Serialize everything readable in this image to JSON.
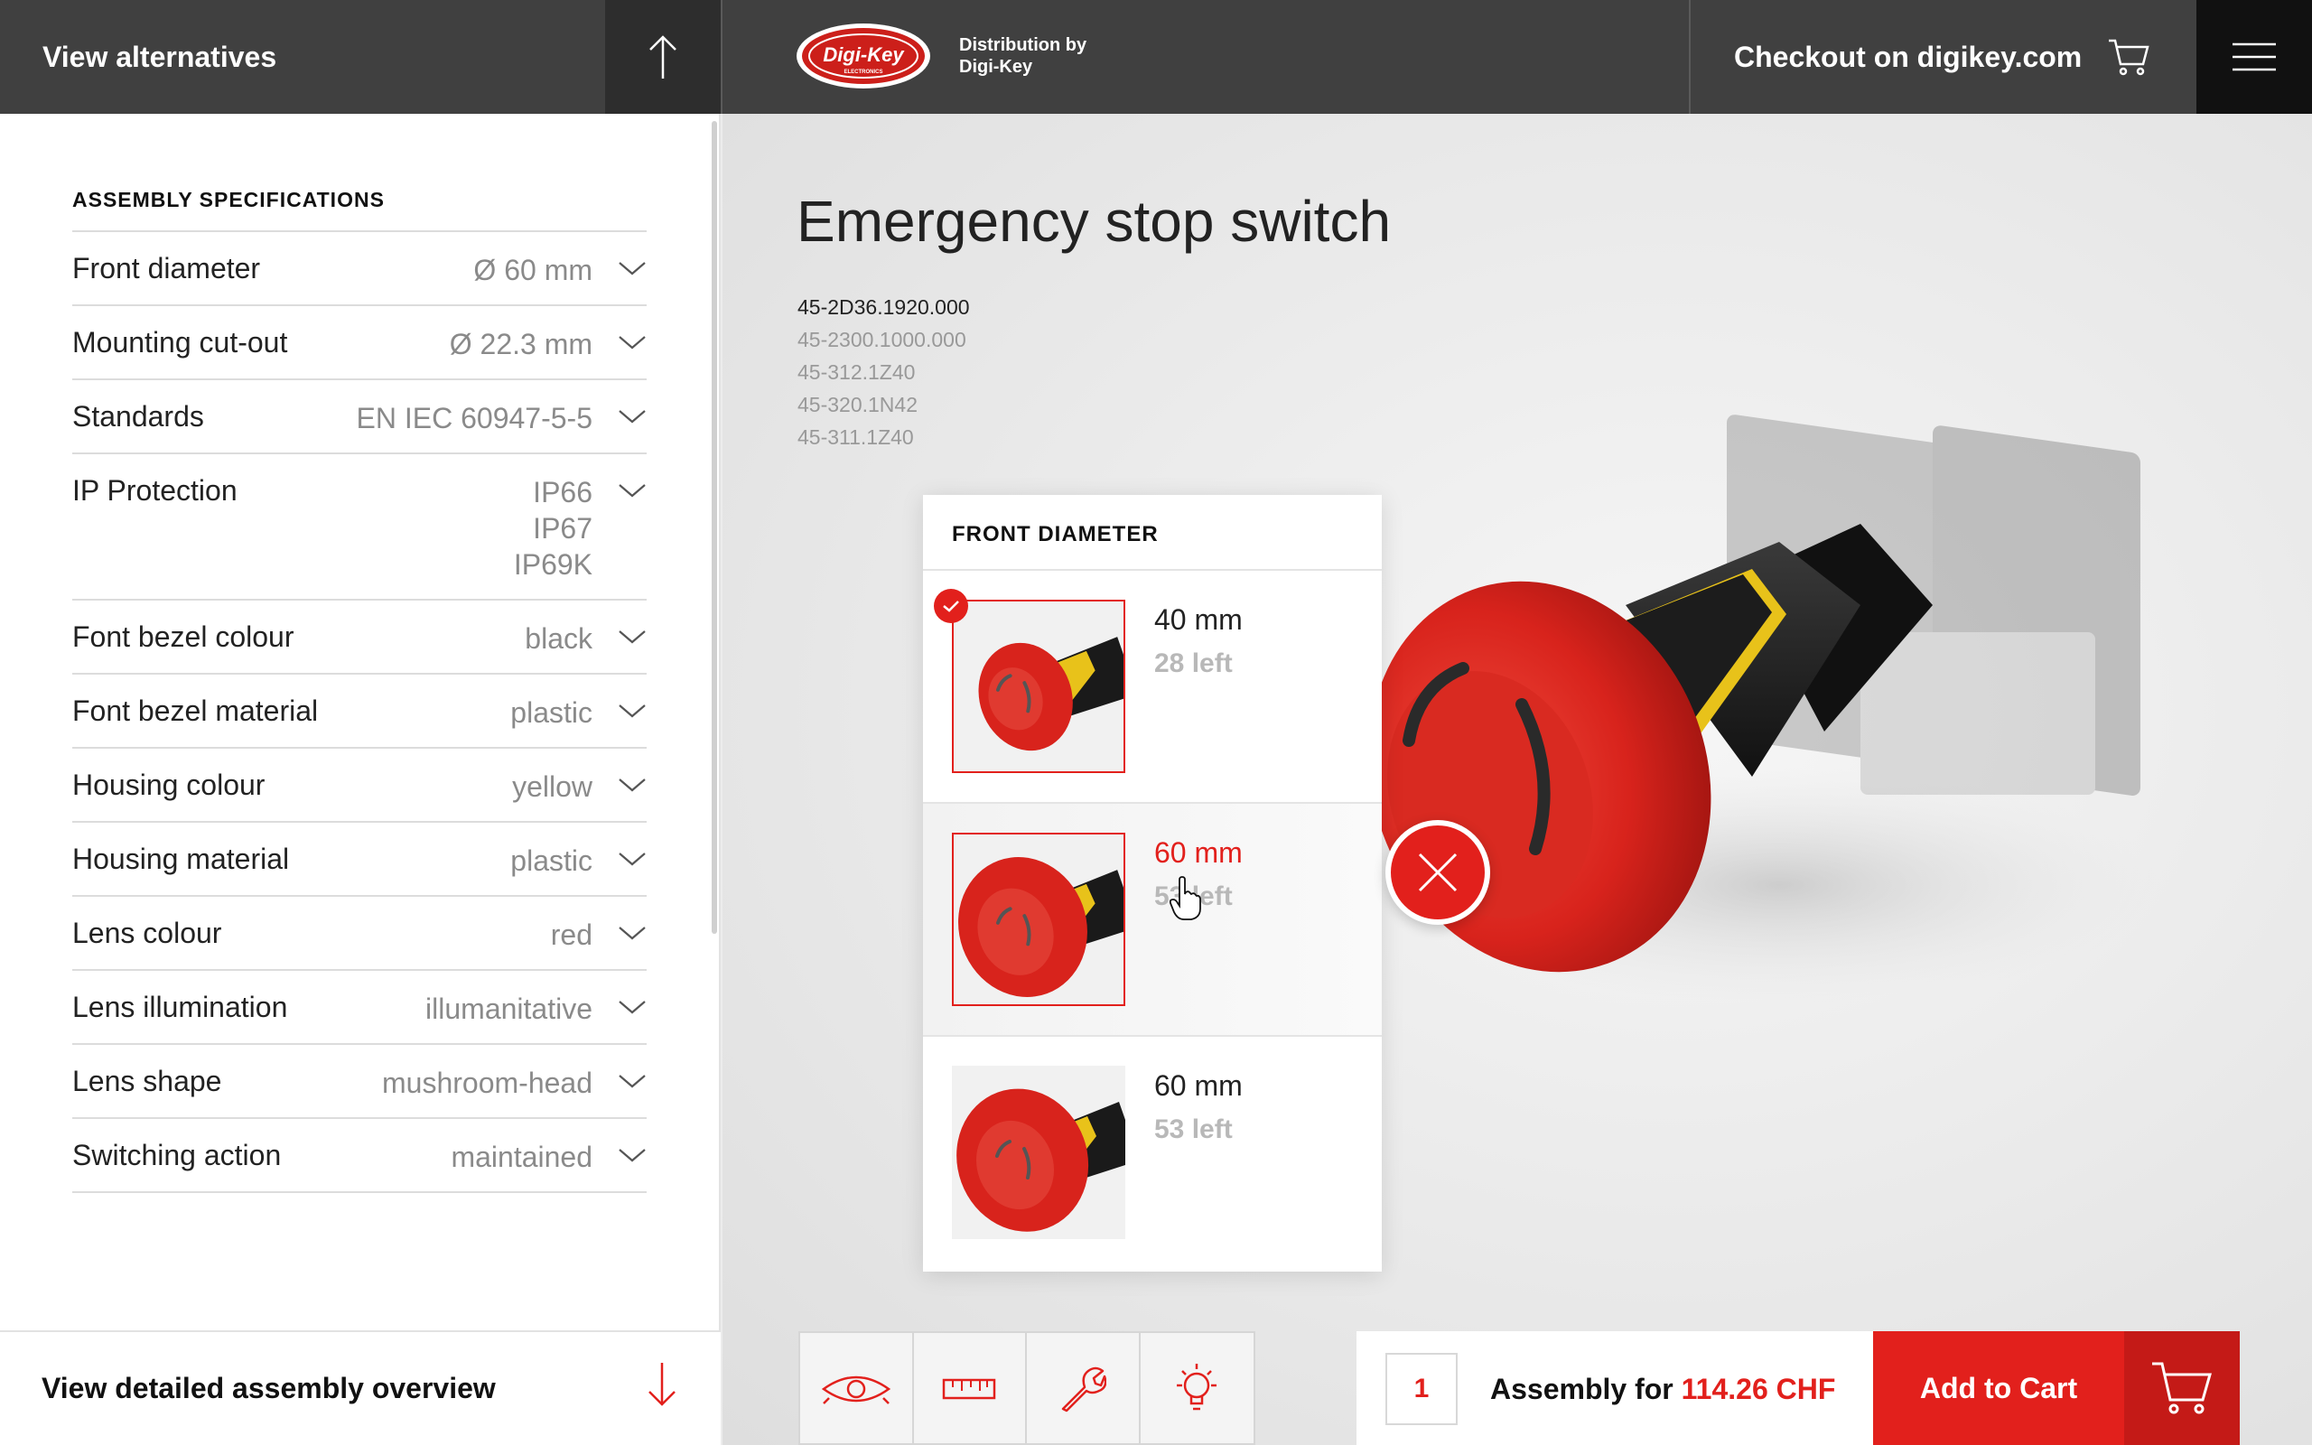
{
  "header": {
    "alternatives_label": "View alternatives",
    "distribution_line1": "Distribution by",
    "distribution_line2": "Digi-Key",
    "logo_text": "Digi-Key",
    "logo_sub": "ELECTRONICS",
    "checkout_label": "Checkout on digikey.com"
  },
  "specs": {
    "title": "ASSEMBLY SPECIFICATIONS",
    "rows": [
      {
        "label": "Front diameter",
        "values": [
          "Ø 60 mm"
        ]
      },
      {
        "label": "Mounting cut-out",
        "values": [
          "Ø 22.3 mm"
        ]
      },
      {
        "label": "Standards",
        "values": [
          "EN IEC 60947-5-5"
        ]
      },
      {
        "label": "IP Protection",
        "values": [
          "IP66",
          "IP67",
          "IP69K"
        ]
      },
      {
        "label": "Font bezel colour",
        "values": [
          "black"
        ]
      },
      {
        "label": "Font bezel material",
        "values": [
          "plastic"
        ]
      },
      {
        "label": "Housing colour",
        "values": [
          "yellow"
        ]
      },
      {
        "label": "Housing material",
        "values": [
          "plastic"
        ]
      },
      {
        "label": "Lens colour",
        "values": [
          "red"
        ]
      },
      {
        "label": "Lens illumination",
        "values": [
          "illumanitative"
        ]
      },
      {
        "label": "Lens shape",
        "values": [
          "mushroom-head"
        ]
      },
      {
        "label": "Switching action",
        "values": [
          "maintained"
        ]
      }
    ],
    "overview_label": "View detailed assembly overview"
  },
  "product": {
    "title": "Emergency stop switch",
    "part_numbers": [
      "45-2D36.1920.000",
      "45-2300.1000.000",
      "45-312.1Z40",
      "45-320.1N42",
      "45-311.1Z40"
    ]
  },
  "popup": {
    "title": "FRONT DIAMETER",
    "options": [
      {
        "size": "40 mm",
        "stock": "28 left"
      },
      {
        "size": "60 mm",
        "stock": "53 left"
      },
      {
        "size": "60 mm",
        "stock": "53 left"
      }
    ]
  },
  "cart": {
    "quantity": "1",
    "assembly_label": "Assembly for",
    "price": "114.26",
    "currency": "CHF",
    "add_label": "Add to Cart"
  },
  "toolbar_icons": [
    "eye-icon",
    "ruler-icon",
    "wrench-icon",
    "lightbulb-icon"
  ],
  "colors": {
    "accent": "#e2201c",
    "header": "#404040"
  }
}
